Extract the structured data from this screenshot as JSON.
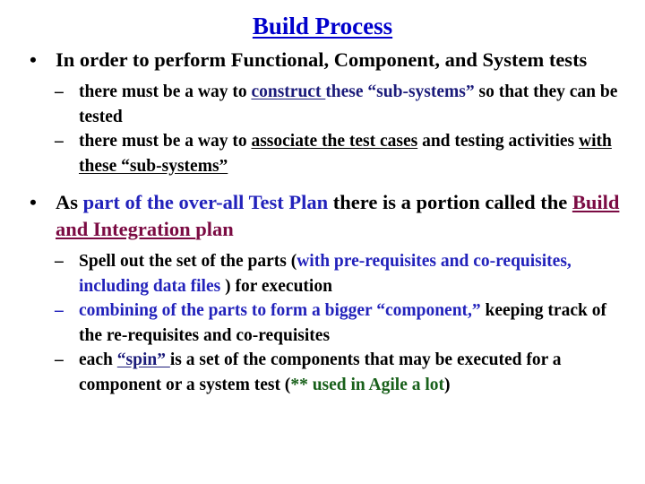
{
  "slide": {
    "title": "Build Process",
    "colors": {
      "title_blue": "#0000CC",
      "navy": "#1B1B7A",
      "blue": "#2222BB",
      "maroon": "#7B0B43",
      "green": "#18601A",
      "black": "#000000",
      "background": "#FFFFFF"
    },
    "bullet_glyph": "•",
    "dash_glyph": "–",
    "blocks": [
      {
        "level": 1,
        "runs": [
          {
            "text": "In order to perform Functional, Component, and System tests",
            "color": "black",
            "underline": false
          }
        ]
      },
      {
        "level": 2,
        "dash_color": "black",
        "runs": [
          {
            "text": "there must be a way to ",
            "color": "black",
            "underline": false
          },
          {
            "text": "construct ",
            "color": "navy",
            "underline": true
          },
          {
            "text": "these “sub-systems” ",
            "color": "navy",
            "underline": false
          },
          {
            "text": "so that they can be tested",
            "color": "black",
            "underline": false
          }
        ]
      },
      {
        "level": 2,
        "dash_color": "black",
        "runs": [
          {
            "text": "there must be a way to ",
            "color": "black",
            "underline": false
          },
          {
            "text": "associate the test cases",
            "color": "black",
            "underline": true
          },
          {
            "text": " and testing activities ",
            "color": "black",
            "underline": false
          },
          {
            "text": "with these “sub-systems”",
            "color": "black",
            "underline": true
          }
        ]
      },
      {
        "level": 1,
        "runs": [
          {
            "text": "As ",
            "color": "black",
            "underline": false
          },
          {
            "text": "part of the over-all Test Plan",
            "color": "blue",
            "underline": false
          },
          {
            "text": " there is a portion called the ",
            "color": "black",
            "underline": false
          },
          {
            "text": "Build and Integration ",
            "color": "maroon",
            "underline": true
          },
          {
            "text": "plan",
            "color": "maroon",
            "underline": false
          }
        ]
      },
      {
        "level": 2,
        "dash_color": "black",
        "runs": [
          {
            "text": "Spell out the set of the parts (",
            "color": "black",
            "underline": false
          },
          {
            "text": "with pre-requisites and co-requisites, including data files",
            "color": "blue",
            "underline": false
          },
          {
            "text": " ) for execution",
            "color": "black",
            "underline": false
          }
        ]
      },
      {
        "level": 2,
        "dash_color": "blue",
        "runs": [
          {
            "text": "combining of the parts to form a bigger “component,”",
            "color": "blue",
            "underline": false
          },
          {
            "text": " keeping track of the re-requisites and co-requisites",
            "color": "black",
            "underline": false
          }
        ]
      },
      {
        "level": 2,
        "dash_color": "black",
        "runs": [
          {
            "text": "each ",
            "color": "black",
            "underline": false
          },
          {
            "text": "“spin” ",
            "color": "navy",
            "underline": true
          },
          {
            "text": "is a set of the components that may be executed for a component or a system test (",
            "color": "black",
            "underline": false
          },
          {
            "text": "** used in Agile a lot",
            "color": "green",
            "underline": false
          },
          {
            "text": ")",
            "color": "black",
            "underline": false
          }
        ]
      }
    ]
  }
}
